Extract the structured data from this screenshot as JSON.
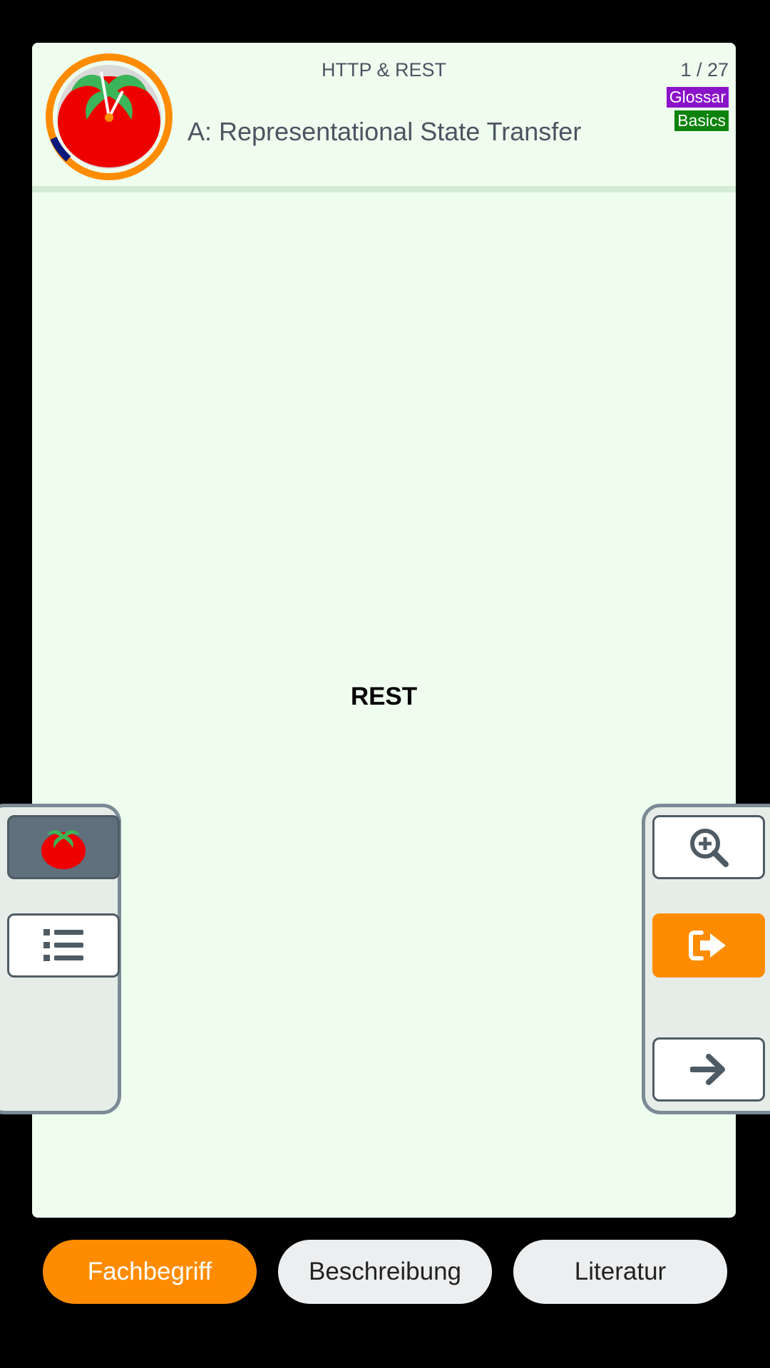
{
  "card": {
    "topic": "HTTP & REST",
    "counter": "1 / 27",
    "tags": [
      "Glossar",
      "Basics"
    ],
    "question": "A: Representational State Transfer",
    "term": "REST"
  },
  "tabs": [
    {
      "label": "Fachbegriff",
      "active": true
    },
    {
      "label": "Beschreibung",
      "active": false
    },
    {
      "label": "Literatur",
      "active": false
    }
  ],
  "icons": {
    "timer": "tomato-timer-icon",
    "tomato": "tomato-icon",
    "list": "list-icon",
    "zoom": "zoom-in-icon",
    "exit": "exit-icon",
    "next": "arrow-right-icon"
  },
  "colors": {
    "accent": "#ff8c00",
    "card_bg": "#effdef",
    "tag_glossar": "#8a12c8",
    "tag_basics": "#0b820b"
  }
}
